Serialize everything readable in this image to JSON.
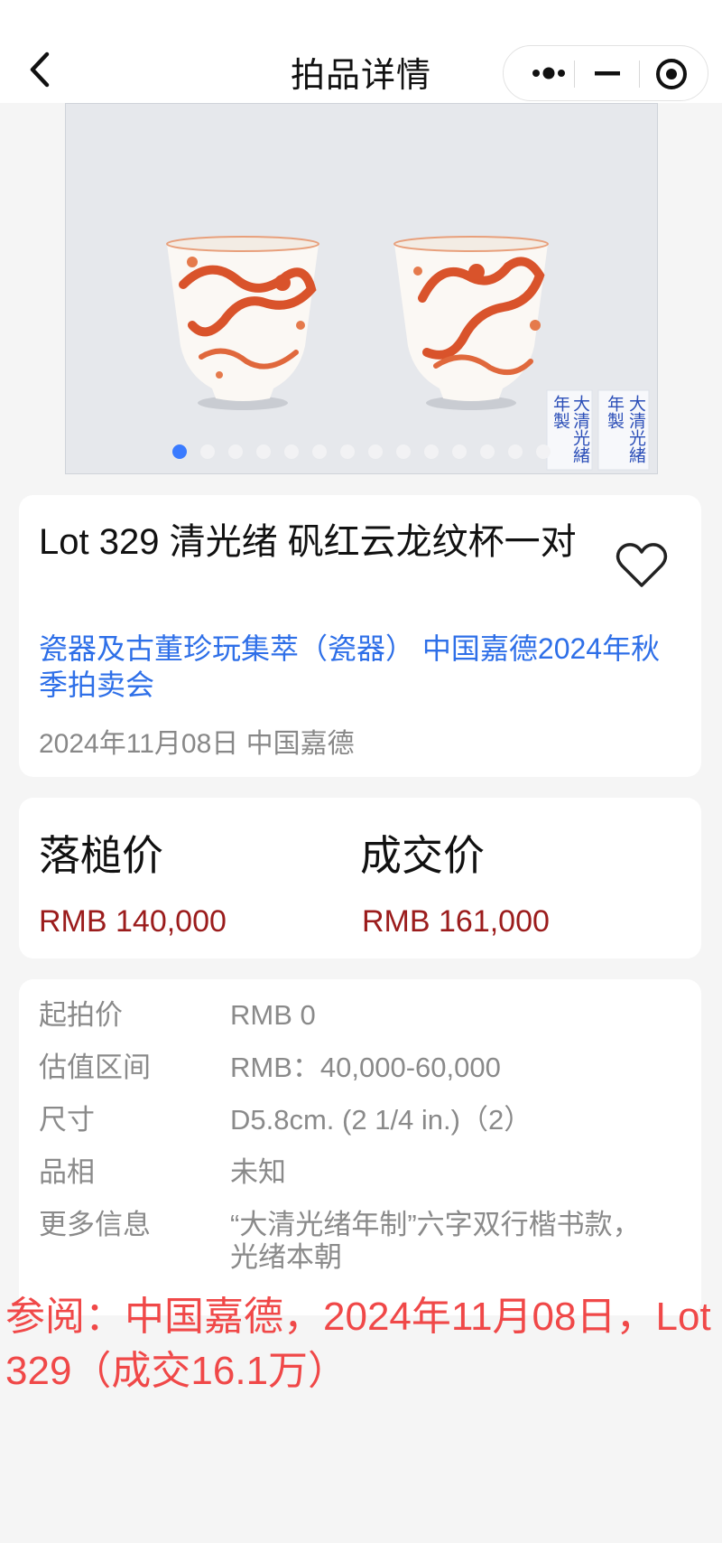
{
  "navbar": {
    "title": "拍品详情",
    "back_icon": "chevron-left-icon",
    "menu_icon": "more-dots-icon",
    "minimize_icon": "minus-icon",
    "close_icon": "target-circle-icon"
  },
  "gallery": {
    "image_alt": "pair of iron-red dragon cups with reign marks",
    "mark_text": "大清光緒年製",
    "slide_count": 14,
    "active_index": 0
  },
  "lot": {
    "title": "Lot 329 清光绪 矾红云龙纹杯一对",
    "auction": "瓷器及古董珍玩集萃（瓷器） 中国嘉德2024年秋季拍卖会",
    "date_house": "2024年11月08日 中国嘉德",
    "favorite_icon": "heart-outline-icon"
  },
  "prices": {
    "hammer_label": "落槌价",
    "hammer_value": "RMB 140,000",
    "final_label": "成交价",
    "final_value": "RMB 161,000"
  },
  "details": [
    {
      "key": "起拍价",
      "value": "RMB 0"
    },
    {
      "key": "估值区间",
      "value": "RMB：40,000-60,000"
    },
    {
      "key": "尺寸",
      "value": "D5.8cm. (2 1/4 in.)（2）"
    },
    {
      "key": "品相",
      "value": "未知"
    },
    {
      "key": "更多信息",
      "value": "“大清光绪年制”六字双行楷书款，光绪本朝"
    }
  ],
  "note": "参阅：中国嘉德，2024年11月08日，Lot 329（成交16.1万）",
  "colors": {
    "accent_blue": "#2e6fe8",
    "price_red": "#9b1c1c",
    "note_red": "#f04848",
    "dot_active": "#3a7bff"
  }
}
